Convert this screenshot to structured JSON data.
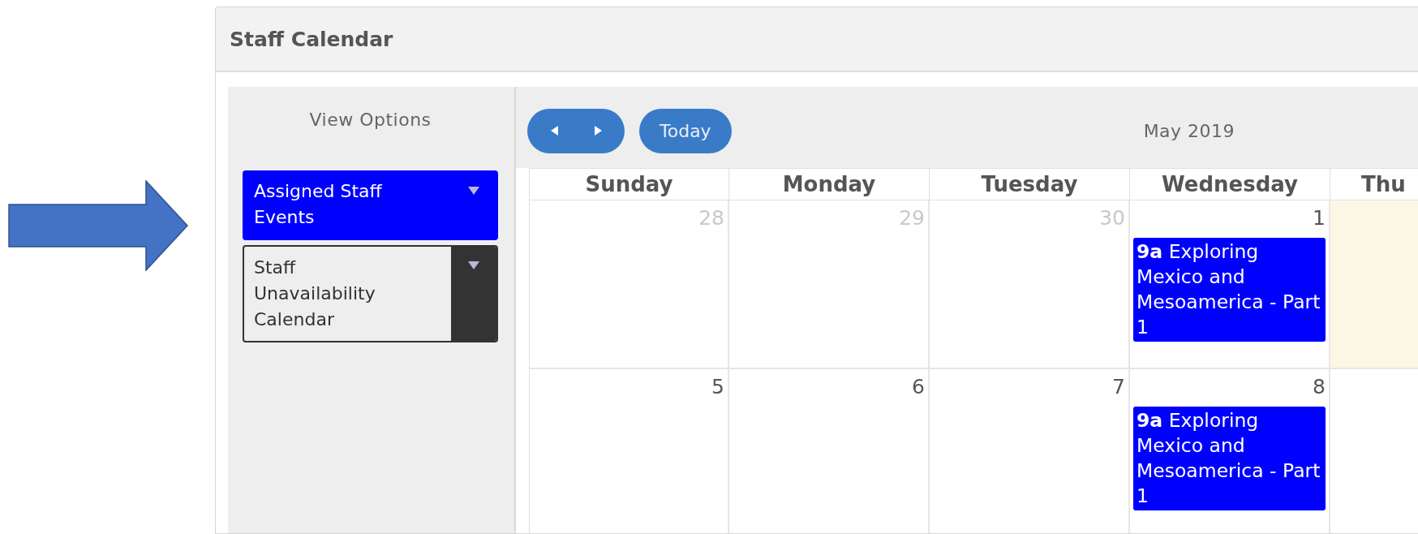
{
  "window": {
    "title": "Staff Calendar"
  },
  "sidebar": {
    "title": "View Options",
    "calendars": [
      {
        "label": "Assigned Staff Events",
        "selected": true,
        "color": "#0000ff"
      },
      {
        "label": "Staff Unavailability Calendar",
        "selected": false,
        "color": "#333333"
      }
    ]
  },
  "toolbar": {
    "today_label": "Today",
    "month": "May 2019"
  },
  "columns": [
    "Sunday",
    "Monday",
    "Tuesday",
    "Wednesday",
    "Thu"
  ],
  "weeks": [
    [
      {
        "date": "28",
        "other_month": true,
        "today": false
      },
      {
        "date": "29",
        "other_month": true,
        "today": false
      },
      {
        "date": "30",
        "other_month": true,
        "today": false
      },
      {
        "date": "1",
        "other_month": false,
        "today": false,
        "events": [
          {
            "text": "**9a** Exploring Mexico and Mesoamerica - Part 1",
            "color": "#0000ff"
          }
        ]
      },
      {
        "today": true
      }
    ],
    [
      {
        "date": "5",
        "other_month": false,
        "today": false
      },
      {
        "date": "6",
        "other_month": false,
        "today": false
      },
      {
        "date": "7",
        "other_month": false,
        "today": false
      },
      {
        "date": "8",
        "other_month": false,
        "today": false,
        "events": [
          {
            "text": "**9a** Exploring Mexico and Mesoamerica - Part 1",
            "color": "#0000ff"
          }
        ]
      }
    ]
  ]
}
